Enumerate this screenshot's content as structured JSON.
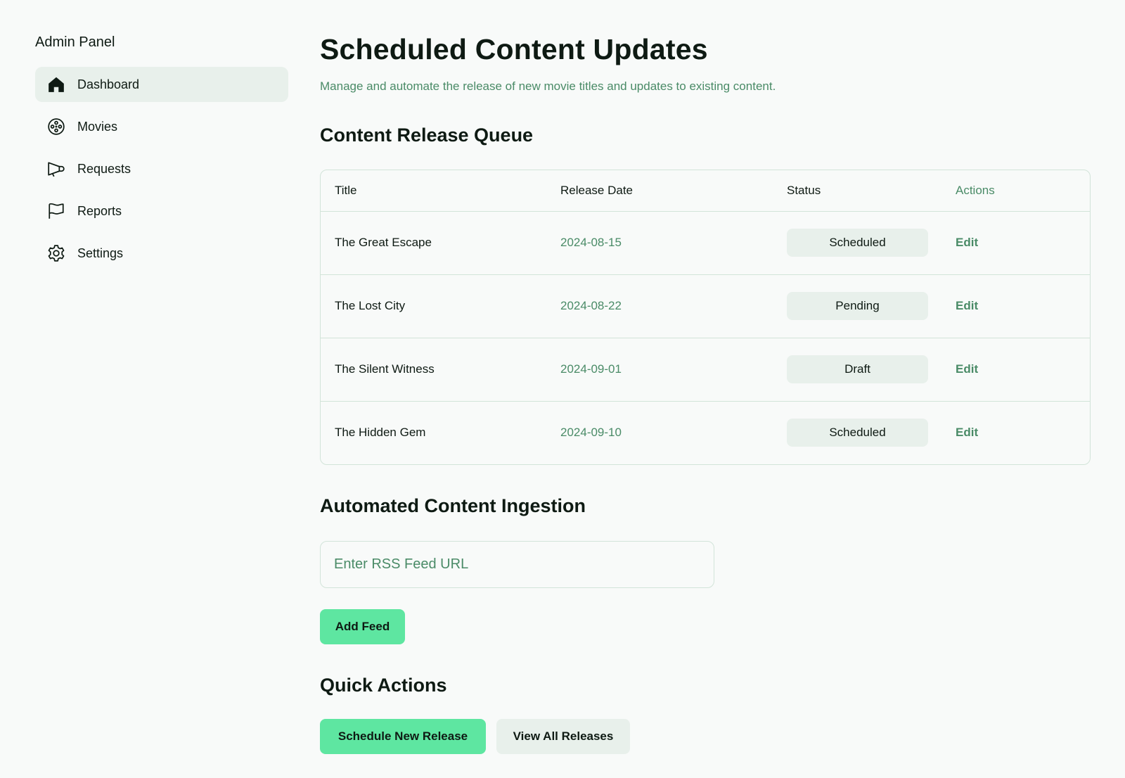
{
  "sidebar": {
    "brand": "Admin Panel",
    "items": [
      {
        "label": "Dashboard",
        "icon": "home-icon",
        "active": true
      },
      {
        "label": "Movies",
        "icon": "film-reel-icon",
        "active": false
      },
      {
        "label": "Requests",
        "icon": "megaphone-icon",
        "active": false
      },
      {
        "label": "Reports",
        "icon": "flag-icon",
        "active": false
      },
      {
        "label": "Settings",
        "icon": "gear-icon",
        "active": false
      }
    ]
  },
  "header": {
    "title": "Scheduled Content Updates",
    "subtitle": "Manage and automate the release of new movie titles and updates to existing content."
  },
  "queue": {
    "title": "Content Release Queue",
    "columns": [
      "Title",
      "Release Date",
      "Status",
      "Actions"
    ],
    "rows": [
      {
        "title": "The Great Escape",
        "date": "2024-08-15",
        "status": "Scheduled",
        "action": "Edit"
      },
      {
        "title": "The Lost City",
        "date": "2024-08-22",
        "status": "Pending",
        "action": "Edit"
      },
      {
        "title": "The Silent Witness",
        "date": "2024-09-01",
        "status": "Draft",
        "action": "Edit"
      },
      {
        "title": "The Hidden Gem",
        "date": "2024-09-10",
        "status": "Scheduled",
        "action": "Edit"
      }
    ]
  },
  "ingestion": {
    "title": "Automated Content Ingestion",
    "input_placeholder": "Enter RSS Feed URL",
    "input_value": "",
    "add_button": "Add Feed"
  },
  "quick_actions": {
    "title": "Quick Actions",
    "schedule_button": "Schedule New Release",
    "view_all_button": "View All Releases"
  },
  "colors": {
    "accent": "#5ee6a1",
    "muted_green": "#4a8b67",
    "pill_bg": "#e8f0eb",
    "border": "#d2e4d9",
    "background": "#f8faf9"
  }
}
